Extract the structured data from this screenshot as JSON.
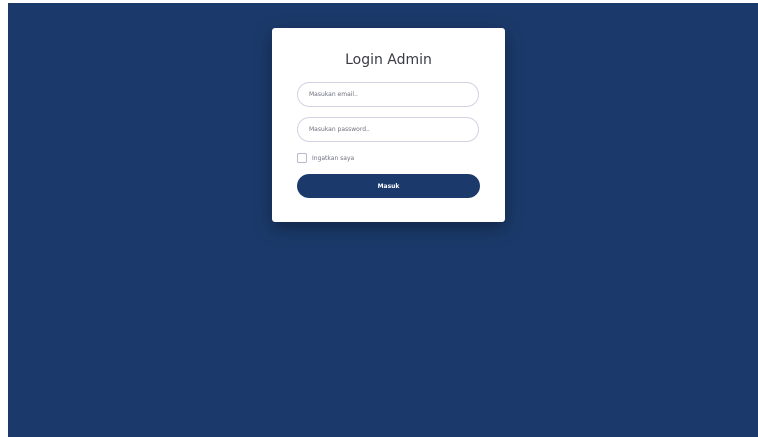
{
  "login": {
    "title": "Login Admin",
    "email_placeholder": "Masukan email..",
    "password_placeholder": "Masukan password..",
    "remember_label": "Ingatkan saya",
    "submit_label": "Masuk"
  },
  "colors": {
    "background": "#1b3a6b",
    "card": "#ffffff",
    "button": "#1b3a6b"
  }
}
